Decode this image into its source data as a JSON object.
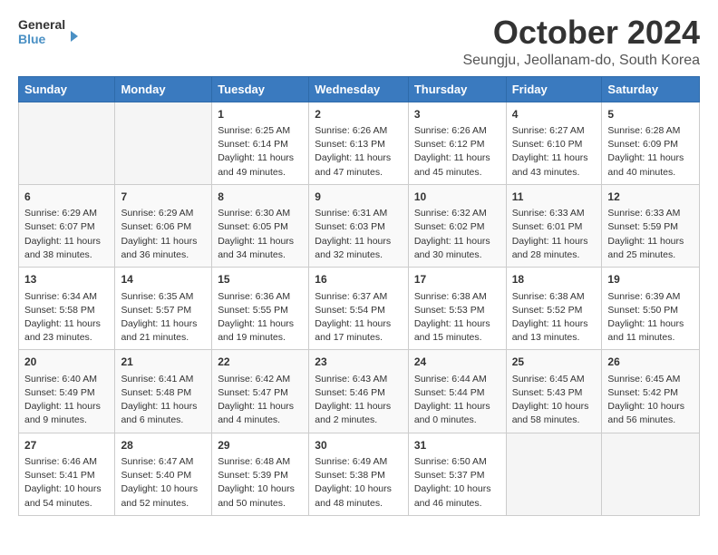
{
  "header": {
    "logo_line1": "General",
    "logo_line2": "Blue",
    "month": "October 2024",
    "location": "Seungju, Jeollanam-do, South Korea"
  },
  "weekdays": [
    "Sunday",
    "Monday",
    "Tuesday",
    "Wednesday",
    "Thursday",
    "Friday",
    "Saturday"
  ],
  "weeks": [
    [
      {
        "day": "",
        "empty": true
      },
      {
        "day": "",
        "empty": true
      },
      {
        "day": "1",
        "sunrise": "6:25 AM",
        "sunset": "6:14 PM",
        "daylight": "11 hours and 49 minutes."
      },
      {
        "day": "2",
        "sunrise": "6:26 AM",
        "sunset": "6:13 PM",
        "daylight": "11 hours and 47 minutes."
      },
      {
        "day": "3",
        "sunrise": "6:26 AM",
        "sunset": "6:12 PM",
        "daylight": "11 hours and 45 minutes."
      },
      {
        "day": "4",
        "sunrise": "6:27 AM",
        "sunset": "6:10 PM",
        "daylight": "11 hours and 43 minutes."
      },
      {
        "day": "5",
        "sunrise": "6:28 AM",
        "sunset": "6:09 PM",
        "daylight": "11 hours and 40 minutes."
      }
    ],
    [
      {
        "day": "6",
        "sunrise": "6:29 AM",
        "sunset": "6:07 PM",
        "daylight": "11 hours and 38 minutes."
      },
      {
        "day": "7",
        "sunrise": "6:29 AM",
        "sunset": "6:06 PM",
        "daylight": "11 hours and 36 minutes."
      },
      {
        "day": "8",
        "sunrise": "6:30 AM",
        "sunset": "6:05 PM",
        "daylight": "11 hours and 34 minutes."
      },
      {
        "day": "9",
        "sunrise": "6:31 AM",
        "sunset": "6:03 PM",
        "daylight": "11 hours and 32 minutes."
      },
      {
        "day": "10",
        "sunrise": "6:32 AM",
        "sunset": "6:02 PM",
        "daylight": "11 hours and 30 minutes."
      },
      {
        "day": "11",
        "sunrise": "6:33 AM",
        "sunset": "6:01 PM",
        "daylight": "11 hours and 28 minutes."
      },
      {
        "day": "12",
        "sunrise": "6:33 AM",
        "sunset": "5:59 PM",
        "daylight": "11 hours and 25 minutes."
      }
    ],
    [
      {
        "day": "13",
        "sunrise": "6:34 AM",
        "sunset": "5:58 PM",
        "daylight": "11 hours and 23 minutes."
      },
      {
        "day": "14",
        "sunrise": "6:35 AM",
        "sunset": "5:57 PM",
        "daylight": "11 hours and 21 minutes."
      },
      {
        "day": "15",
        "sunrise": "6:36 AM",
        "sunset": "5:55 PM",
        "daylight": "11 hours and 19 minutes."
      },
      {
        "day": "16",
        "sunrise": "6:37 AM",
        "sunset": "5:54 PM",
        "daylight": "11 hours and 17 minutes."
      },
      {
        "day": "17",
        "sunrise": "6:38 AM",
        "sunset": "5:53 PM",
        "daylight": "11 hours and 15 minutes."
      },
      {
        "day": "18",
        "sunrise": "6:38 AM",
        "sunset": "5:52 PM",
        "daylight": "11 hours and 13 minutes."
      },
      {
        "day": "19",
        "sunrise": "6:39 AM",
        "sunset": "5:50 PM",
        "daylight": "11 hours and 11 minutes."
      }
    ],
    [
      {
        "day": "20",
        "sunrise": "6:40 AM",
        "sunset": "5:49 PM",
        "daylight": "11 hours and 9 minutes."
      },
      {
        "day": "21",
        "sunrise": "6:41 AM",
        "sunset": "5:48 PM",
        "daylight": "11 hours and 6 minutes."
      },
      {
        "day": "22",
        "sunrise": "6:42 AM",
        "sunset": "5:47 PM",
        "daylight": "11 hours and 4 minutes."
      },
      {
        "day": "23",
        "sunrise": "6:43 AM",
        "sunset": "5:46 PM",
        "daylight": "11 hours and 2 minutes."
      },
      {
        "day": "24",
        "sunrise": "6:44 AM",
        "sunset": "5:44 PM",
        "daylight": "11 hours and 0 minutes."
      },
      {
        "day": "25",
        "sunrise": "6:45 AM",
        "sunset": "5:43 PM",
        "daylight": "10 hours and 58 minutes."
      },
      {
        "day": "26",
        "sunrise": "6:45 AM",
        "sunset": "5:42 PM",
        "daylight": "10 hours and 56 minutes."
      }
    ],
    [
      {
        "day": "27",
        "sunrise": "6:46 AM",
        "sunset": "5:41 PM",
        "daylight": "10 hours and 54 minutes."
      },
      {
        "day": "28",
        "sunrise": "6:47 AM",
        "sunset": "5:40 PM",
        "daylight": "10 hours and 52 minutes."
      },
      {
        "day": "29",
        "sunrise": "6:48 AM",
        "sunset": "5:39 PM",
        "daylight": "10 hours and 50 minutes."
      },
      {
        "day": "30",
        "sunrise": "6:49 AM",
        "sunset": "5:38 PM",
        "daylight": "10 hours and 48 minutes."
      },
      {
        "day": "31",
        "sunrise": "6:50 AM",
        "sunset": "5:37 PM",
        "daylight": "10 hours and 46 minutes."
      },
      {
        "day": "",
        "empty": true
      },
      {
        "day": "",
        "empty": true
      }
    ]
  ],
  "labels": {
    "sunrise": "Sunrise:",
    "sunset": "Sunset:",
    "daylight": "Daylight:"
  }
}
